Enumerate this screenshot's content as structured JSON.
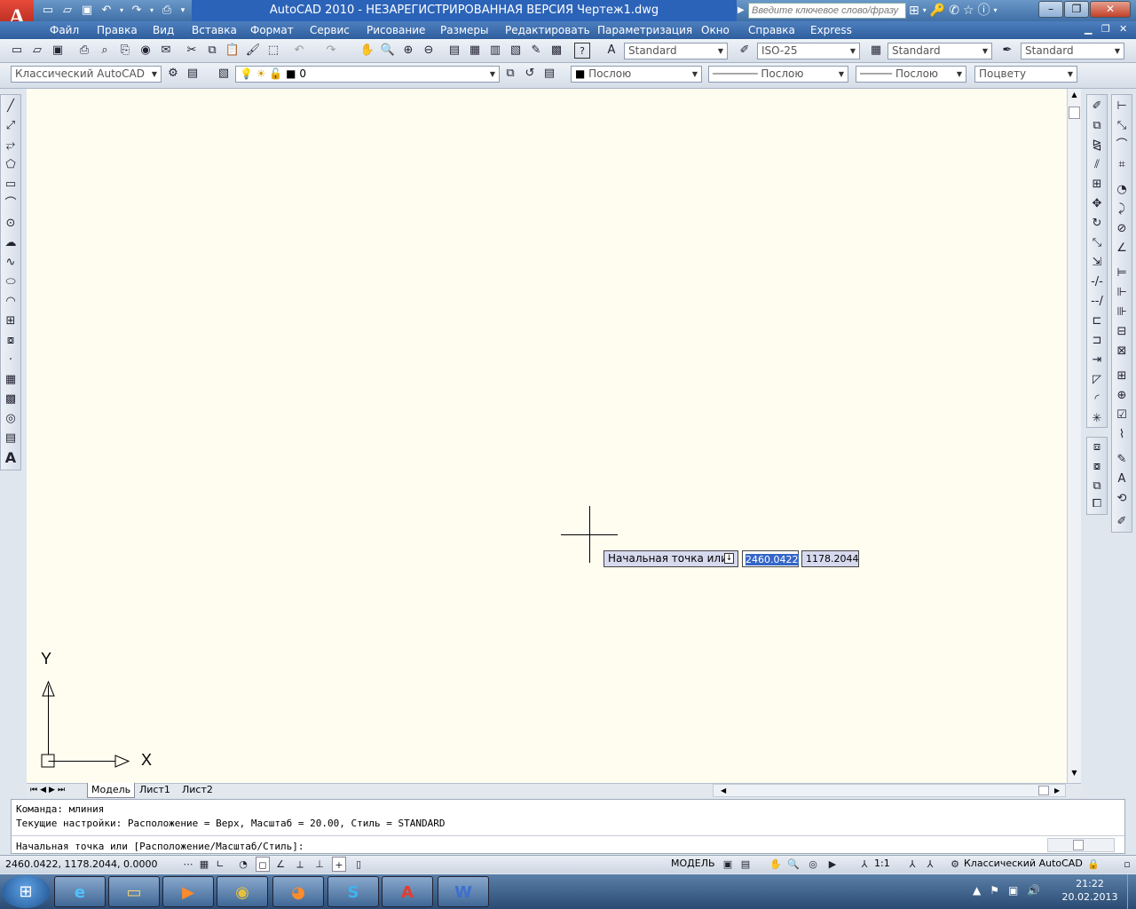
{
  "app": {
    "logo_letter": "A",
    "title": "AutoCAD 2010 - НЕЗАРЕГИСТРИРОВАННАЯ ВЕРСИЯ     Чертеж1.dwg",
    "search_placeholder": "Введите ключевое слово/фразу"
  },
  "menu": [
    "Файл",
    "Правка",
    "Вид",
    "Вставка",
    "Формат",
    "Сервис",
    "Рисование",
    "Размеры",
    "Редактировать",
    "Параметризация",
    "Окно",
    "Справка",
    "Express"
  ],
  "styles": {
    "text_style": "Standard",
    "dim_style": "ISO-25",
    "table_style": "Standard",
    "mleader_style": "Standard"
  },
  "layers": {
    "workspace": "Классический AutoCAD",
    "layer": "0",
    "color": "Послою",
    "linetype": "Послою",
    "lineweight": "Послою",
    "plotstyle": "Поцвету"
  },
  "tabs": [
    "Модель",
    "Лист1",
    "Лист2"
  ],
  "ucs": {
    "x_label": "X",
    "y_label": "Y"
  },
  "dynamic_input": {
    "prompt": "Начальная точка или",
    "x_value": "2460.0422",
    "y_value": "1178.2044"
  },
  "command": {
    "line1": "Команда: млиния",
    "line2": "Текущие настройки: Расположение = Верх, Масштаб = 20.00, Стиль = STANDARD",
    "line3": "Начальная точка или [Расположение/Масштаб/Стиль]:"
  },
  "status": {
    "coords": "2460.0422, 1178.2044, 0.0000",
    "model_label": "МОДЕЛЬ",
    "scale": "1:1",
    "workspace": "Классический AutoCAD"
  },
  "clock": {
    "time": "21:22",
    "date": "20.02.2013"
  }
}
